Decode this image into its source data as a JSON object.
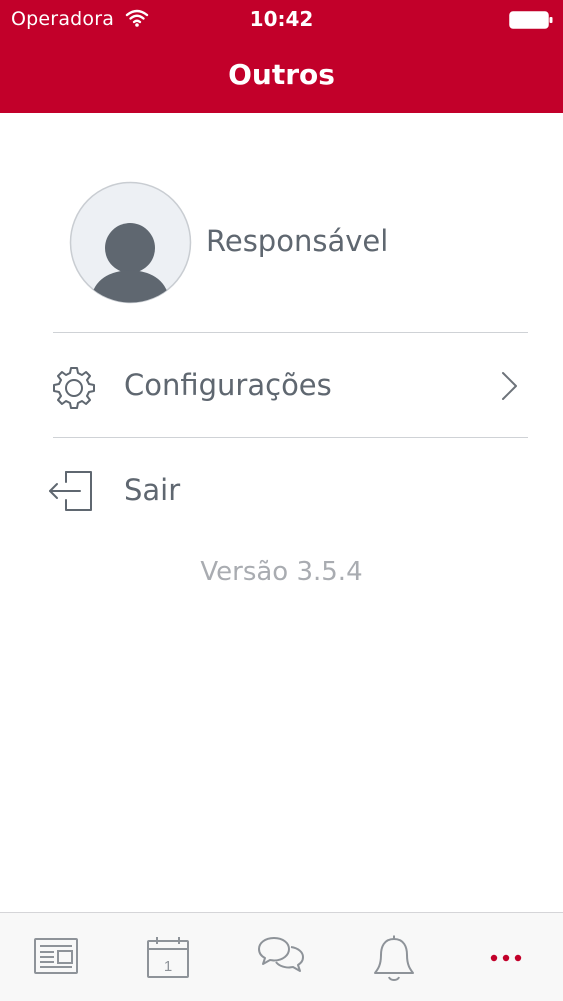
{
  "status_bar": {
    "carrier": "Operadora",
    "time": "10:42",
    "icons": [
      "wifi-icon",
      "battery-icon"
    ]
  },
  "header": {
    "title": "Outros",
    "background_color": "#c2002a"
  },
  "profile": {
    "name": "Responsável",
    "avatar_icon": "user-avatar-icon"
  },
  "menu": {
    "items": [
      {
        "label": "Configurações",
        "icon": "gear-icon",
        "has_chevron": true
      },
      {
        "label": "Sair",
        "icon": "logout-icon",
        "has_chevron": false
      }
    ]
  },
  "version_text": "Versão 3.5.4",
  "tab_bar": {
    "tabs": [
      {
        "icon": "news-icon",
        "selected": false
      },
      {
        "icon": "calendar-icon",
        "calendar_day": "1",
        "selected": false
      },
      {
        "icon": "chat-icon",
        "selected": false
      },
      {
        "icon": "bell-icon",
        "selected": false
      },
      {
        "icon": "more-icon",
        "selected": true
      }
    ],
    "active_color": "#c2002a",
    "inactive_color": "#8e9399"
  }
}
